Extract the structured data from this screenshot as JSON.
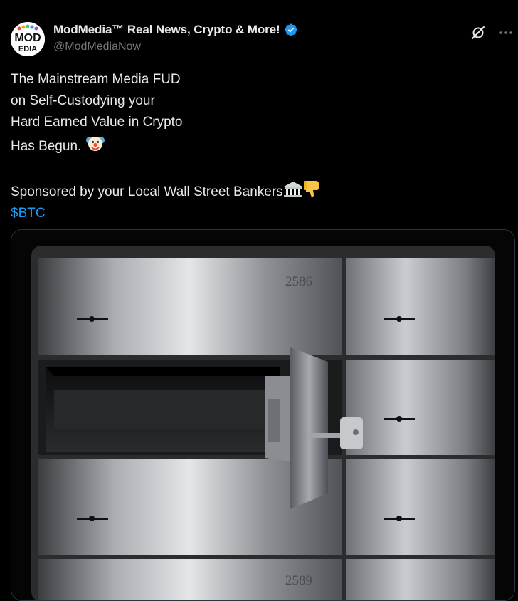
{
  "author": {
    "display_name": "ModMedia™ Real News, Crypto & More!",
    "handle": "@ModMediaNow",
    "avatar_text_top": "MOD",
    "avatar_text_bottom": "EDIA"
  },
  "tweet": {
    "lines": [
      "The Mainstream Media FUD",
      "on Self-Custodying your",
      "Hard Earned Value in Crypto",
      "Has Begun."
    ],
    "sponsor_line": "Sponsored by your Local Wall Street Bankers",
    "cashtag": "$BTC"
  },
  "icons": {
    "verified": "verified-badge-icon",
    "grok": "grok-icon",
    "more": "more-icon",
    "clown": "clown-face-emoji",
    "bank": "bank-building-emoji",
    "thumbs_down": "thumbs-down-emoji"
  },
  "image": {
    "box_numbers": [
      "2586",
      "2589"
    ]
  },
  "colors": {
    "background": "#000000",
    "text": "#e7e9ea",
    "secondary_text": "#71767b",
    "link": "#1d9bf0",
    "verified": "#1d9bf0"
  }
}
